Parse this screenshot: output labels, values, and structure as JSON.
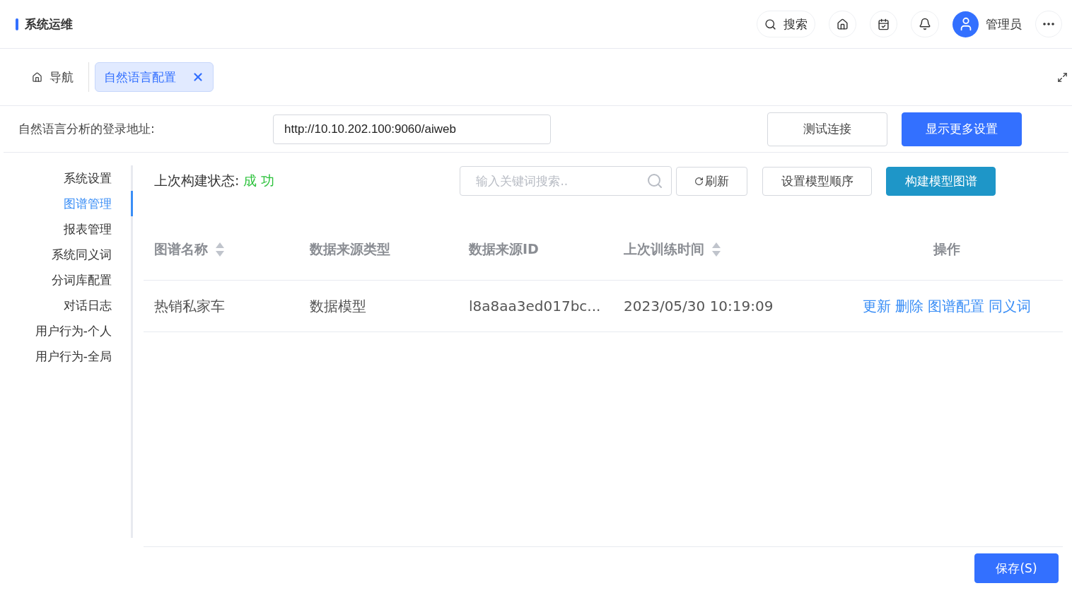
{
  "header": {
    "title": "系统运维",
    "search_label": "搜索",
    "user_name": "管理员"
  },
  "tabs": [
    {
      "label": "导航",
      "kind": "home",
      "selected": false
    },
    {
      "label": "自然语言配置",
      "kind": "closable",
      "selected": true
    }
  ],
  "url_setting": {
    "label": "自然语言分析的登录地址:",
    "value": "http://10.10.202.100:9060/aiweb",
    "test_button": "测试连接",
    "more_button": "显示更多设置"
  },
  "sidebar": {
    "items": [
      {
        "label": "系统设置",
        "selected": false
      },
      {
        "label": "图谱管理",
        "selected": true
      },
      {
        "label": "报表管理",
        "selected": false
      },
      {
        "label": "系统同义词",
        "selected": false
      },
      {
        "label": "分词库配置",
        "selected": false
      },
      {
        "label": "对话日志",
        "selected": false
      },
      {
        "label": "用户行为-个人",
        "selected": false
      },
      {
        "label": "用户行为-全局",
        "selected": false
      }
    ]
  },
  "build_status": {
    "label": "上次构建状态:",
    "value": "成 功"
  },
  "toolbar": {
    "search_placeholder": "输入关键词搜索..",
    "refresh": "刷新",
    "order": "设置模型顺序",
    "build": "构建模型图谱"
  },
  "table": {
    "columns": [
      {
        "label": "图谱名称",
        "sortable": true
      },
      {
        "label": "数据来源类型",
        "sortable": false
      },
      {
        "label": "数据来源ID",
        "sortable": false
      },
      {
        "label": "上次训练时间",
        "sortable": true
      },
      {
        "label": "操作",
        "sortable": false
      }
    ],
    "rows": [
      {
        "cells": [
          "热销私家车",
          "数据模型",
          "l8a8aa3ed017bc...",
          "2023/05/30 10:19:09"
        ],
        "actions": [
          "更新",
          "删除",
          "图谱配置",
          "同义词"
        ]
      }
    ]
  },
  "save_button": "保存(S)"
}
